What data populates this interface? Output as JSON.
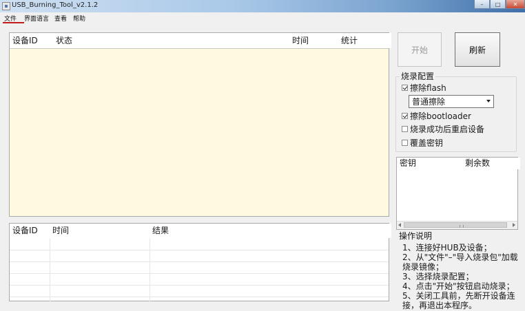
{
  "window": {
    "title": "USB_Burning_Tool_v2.1.2",
    "min_label": "–",
    "max_label": "□",
    "close_label": "✕"
  },
  "menu": {
    "items": [
      "文件",
      "界面语言",
      "查看",
      "帮助"
    ]
  },
  "device_table": {
    "columns": [
      "设备ID",
      "状态",
      "时间",
      "统计"
    ]
  },
  "result_table": {
    "columns": [
      "设备ID",
      "时间",
      "结果"
    ]
  },
  "buttons": {
    "start": "开始",
    "refresh": "刷新"
  },
  "burn_config": {
    "title": "烧录配置",
    "erase_flash": {
      "label": "擦除flash",
      "checked": true
    },
    "erase_mode": "普通擦除",
    "erase_bootloader": {
      "label": "擦除bootloader",
      "checked": true
    },
    "reboot_after": {
      "label": "烧录成功后重启设备",
      "checked": false
    },
    "overwrite_key": {
      "label": "覆盖密钥",
      "checked": false
    }
  },
  "key_table": {
    "columns": [
      "密钥",
      "剩余数"
    ]
  },
  "instructions": {
    "title": "操作说明",
    "lines": [
      "1、连接好HUB及设备；",
      "2、从\"文件\"–\"导入烧录包\"加载",
      "烧录镜像；",
      "3、选择烧录配置；",
      "4、点击\"开始\"按钮启动烧录；",
      "5、关闭工具前，先断开设备连",
      "接，再退出本程序。"
    ]
  },
  "colors": {
    "device_area_bg": "#fdfadf",
    "menu_accent": "#c21b1b"
  }
}
